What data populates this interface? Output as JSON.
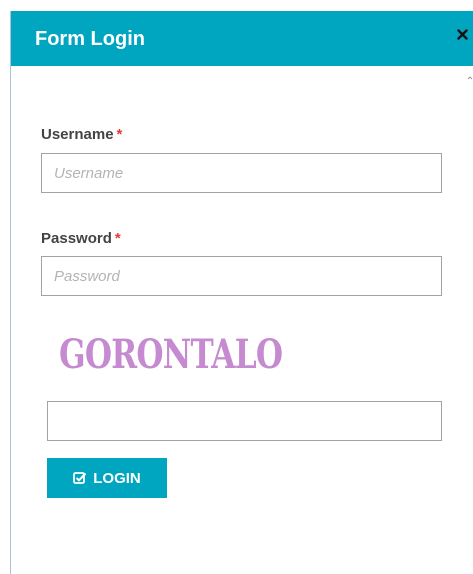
{
  "modal": {
    "title": "Form Login",
    "close_icon": "close-icon"
  },
  "form": {
    "username": {
      "label": "Username",
      "required_mark": "*",
      "placeholder": "Username",
      "value": ""
    },
    "password": {
      "label": "Password",
      "required_mark": "*",
      "placeholder": "Password",
      "value": ""
    },
    "captcha": {
      "text": "GORONTALO",
      "input_value": "",
      "color": "#c58ad0"
    },
    "login_button": {
      "label": "LOGIN",
      "icon": "check-square-icon"
    }
  },
  "colors": {
    "accent": "#00a6c0",
    "required": "#e03b3b"
  }
}
